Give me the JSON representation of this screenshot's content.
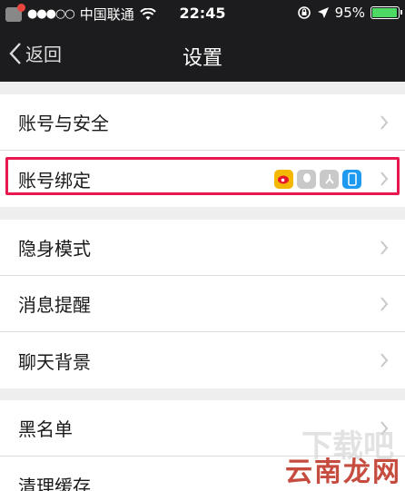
{
  "status_bar": {
    "carrier": "中国联通",
    "time": "22:45",
    "battery_percent": "95%",
    "battery_level": 0.95
  },
  "nav": {
    "back_label": "返回",
    "title": "设置"
  },
  "groups": [
    {
      "items": [
        {
          "label": "账号与安全"
        },
        {
          "label": "账号绑定"
        }
      ]
    },
    {
      "items": [
        {
          "label": "隐身模式"
        },
        {
          "label": "消息提醒"
        },
        {
          "label": "聊天背景"
        }
      ]
    },
    {
      "items": [
        {
          "label": "黑名单"
        },
        {
          "label": "清理缓存"
        }
      ]
    }
  ],
  "binding_icons": [
    "weibo-icon",
    "qq-icon",
    "renren-icon",
    "phone-icon"
  ],
  "watermark": {
    "text": "云南龙网",
    "shadow_text": "下载吧"
  },
  "colors": {
    "bar": "#1c1c1e",
    "highlight": "#e8174f",
    "battery": "#4cd964"
  }
}
